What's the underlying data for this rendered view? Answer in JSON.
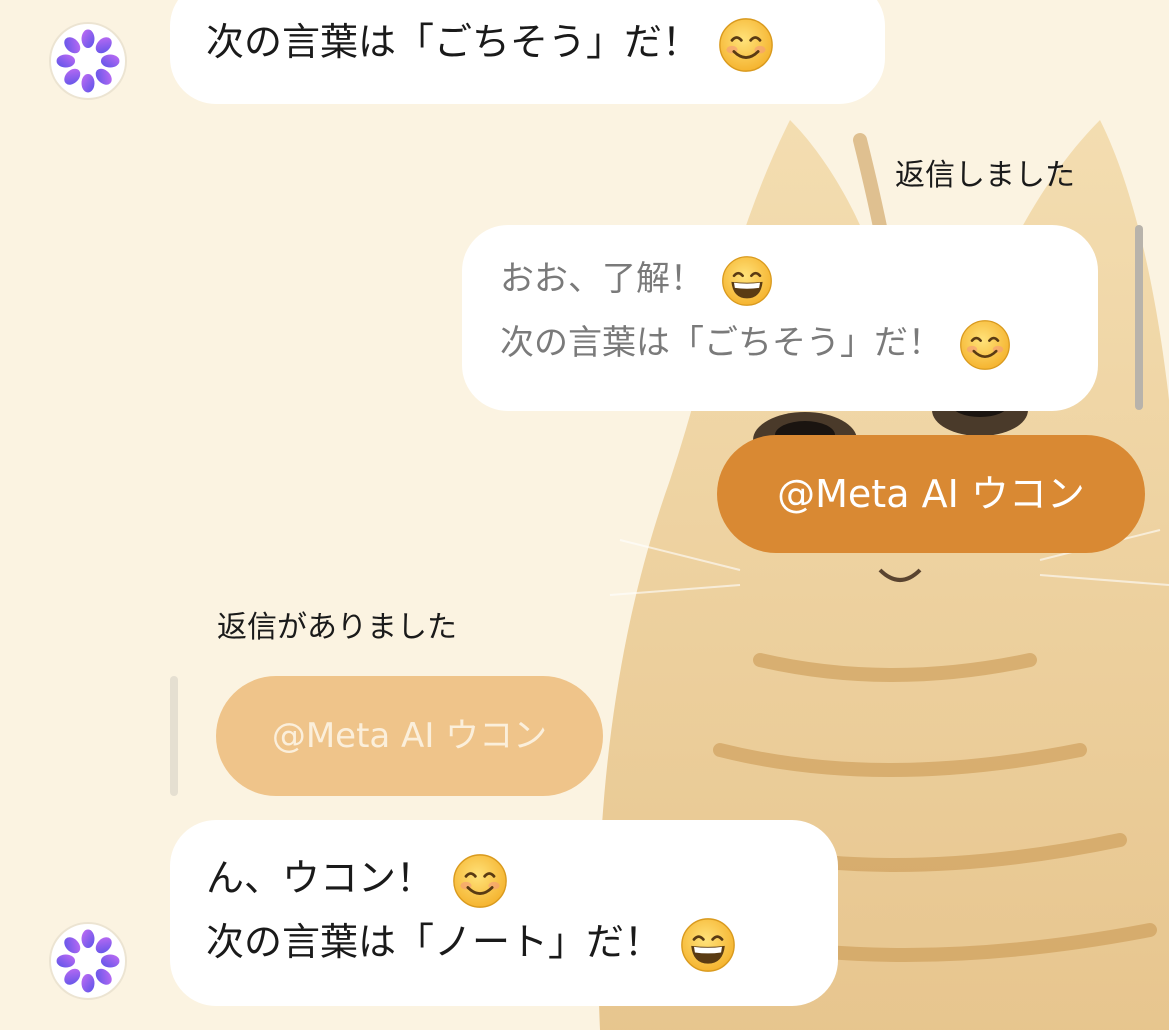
{
  "messages": {
    "top": {
      "line1": "次の言葉は「ごちそう」だ！"
    },
    "replied_label": "返信しました",
    "quoted": {
      "line1": "おお、了解！",
      "line2": "次の言葉は「ごちそう」だ！"
    },
    "sent": {
      "text": "@Meta AI ウコン"
    },
    "reply_received_label": "返信がありました",
    "reply_preview": {
      "text": "@Meta AI ウコン"
    },
    "bottom": {
      "line1": "ん、ウコン！",
      "line2": "次の言葉は「ノート」だ！"
    }
  },
  "icons": {
    "avatar": "meta-ai-avatar-icon",
    "smile": "smiling-face-icon",
    "grin": "grinning-face-icon"
  },
  "colors": {
    "background": "#fbf3e1",
    "sent_bubble": "#d98933",
    "reply_preview_bubble": "#efc48a",
    "received_bubble": "#ffffff"
  }
}
